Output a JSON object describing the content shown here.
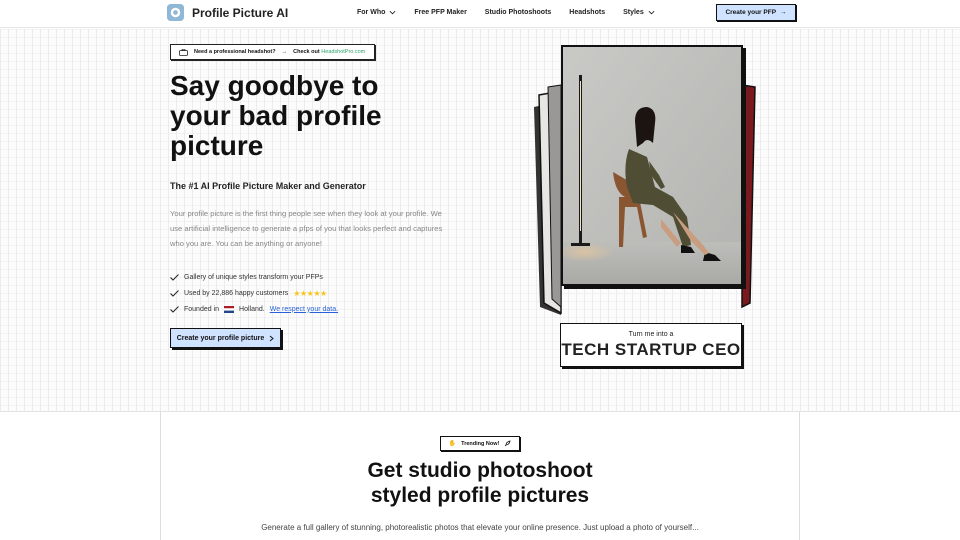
{
  "header": {
    "logo_text": "Profile Picture AI",
    "nav": [
      {
        "label": "For Who",
        "has_dropdown": true
      },
      {
        "label": "Free PFP Maker",
        "has_dropdown": false
      },
      {
        "label": "Studio Photoshoots",
        "has_dropdown": false
      },
      {
        "label": "Headshots",
        "has_dropdown": false
      },
      {
        "label": "Styles",
        "has_dropdown": true
      }
    ],
    "cta_label": "Create your PFP"
  },
  "announcement": {
    "text": "Need a professional headshot?",
    "arrow": "→",
    "prefix": "Check out",
    "link": "HeadshotPro.com"
  },
  "hero": {
    "title": "Say goodbye to your bad profile picture",
    "subtitle": "The #1 AI Profile Picture Maker and Generator",
    "description": "Your profile picture is the first thing people see when they look at your profile. We use artificial intelligence to generate a pfps of you that looks perfect and captures who you are. You can be anything or anyone!",
    "checks": {
      "gallery": "Gallery of unique styles transform your PFPs",
      "used_by": "Used by 22,886 happy customers",
      "stars": "★★★★★",
      "founded": "Founded in",
      "country": "Holland.",
      "data_link": "We respect your data."
    },
    "cta_label": "Create your profile picture"
  },
  "showcase": {
    "turn_small": "Turn me into a",
    "turn_big": "TECH STARTUP CEO"
  },
  "section2": {
    "badge": "Trending Now!",
    "title_line1": "Get studio photoshoot",
    "title_line2": "styled profile pictures",
    "description": "Generate a full gallery of stunning, photorealistic photos that elevate your online presence. Just upload a photo of yourself..."
  },
  "colors": {
    "accent": "#cfe2ff",
    "link_green": "#2fa36b",
    "link_blue": "#2962d9",
    "star": "#f5c518"
  }
}
